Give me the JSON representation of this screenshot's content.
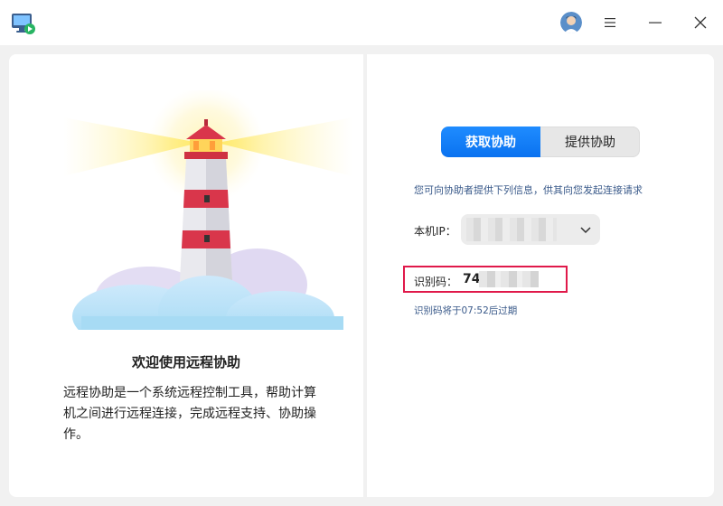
{
  "titlebar": {
    "app_icon": "remote-assistance-icon",
    "menu_icon": "hamburger-menu-icon",
    "minimize_icon": "minimize-icon",
    "close_icon": "close-icon"
  },
  "left": {
    "title": "欢迎使用远程协助",
    "description": "远程协助是一个系统远程控制工具，帮助计算机之间进行远程连接，完成远程支持、协助操作。"
  },
  "right": {
    "tabs": [
      {
        "label": "获取协助",
        "active": true
      },
      {
        "label": "提供协助",
        "active": false
      }
    ],
    "hint": "您可向协助者提供下列信息，供其向您发起连接请求",
    "ip_label": "本机IP：",
    "code_label": "识别码：",
    "code_value": "74",
    "expire_text": "识别码将于07:52后过期"
  },
  "colors": {
    "accent": "#0a72f0",
    "highlight_border": "#e0194a",
    "hint_text": "#3a5a8a"
  }
}
